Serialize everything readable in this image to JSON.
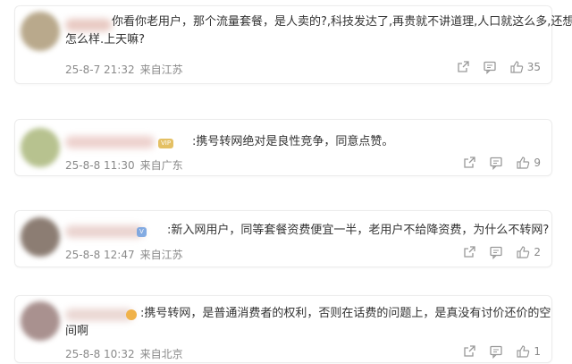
{
  "comments": [
    {
      "text_line1": "你看你老用户，那个流量套餐，是人卖的?,科技发达了,再贵就不讲道理,人口就这么多,还想",
      "text_line2": "怎么样.上天嘛?",
      "date": "25-8-7 21:32",
      "location": "来自江苏",
      "likes": "35",
      "avatar_color": "#b9a98c"
    },
    {
      "badge": "VIP",
      "text_line1": ":携号转网绝对是良性竞争，同意点赞。",
      "date": "25-8-8 11:30",
      "location": "来自广东",
      "likes": "9",
      "avatar_color": "#b7c28f"
    },
    {
      "badge": "V",
      "text_line1": ":新入网用户，同等套餐资费便宜一半，老用户不给降资费，为什么不转网?",
      "date": "25-8-8 12:47",
      "location": "来自江苏",
      "likes": "2",
      "avatar_color": "#8c7d73"
    },
    {
      "text_line1": ":携号转网，是普通消费者的权利，否则在话费的问题上，是真没有讨价还价的空",
      "text_line2": "间啊",
      "date": "25-8-8 10:32",
      "location": "来自北京",
      "likes": "1",
      "avatar_color": "#a9918f"
    }
  ],
  "icons": [
    "share-icon",
    "comment-icon",
    "like-icon"
  ],
  "colors": {
    "meta": "#8a8a8a",
    "text": "#333333",
    "border": "#ececec"
  }
}
